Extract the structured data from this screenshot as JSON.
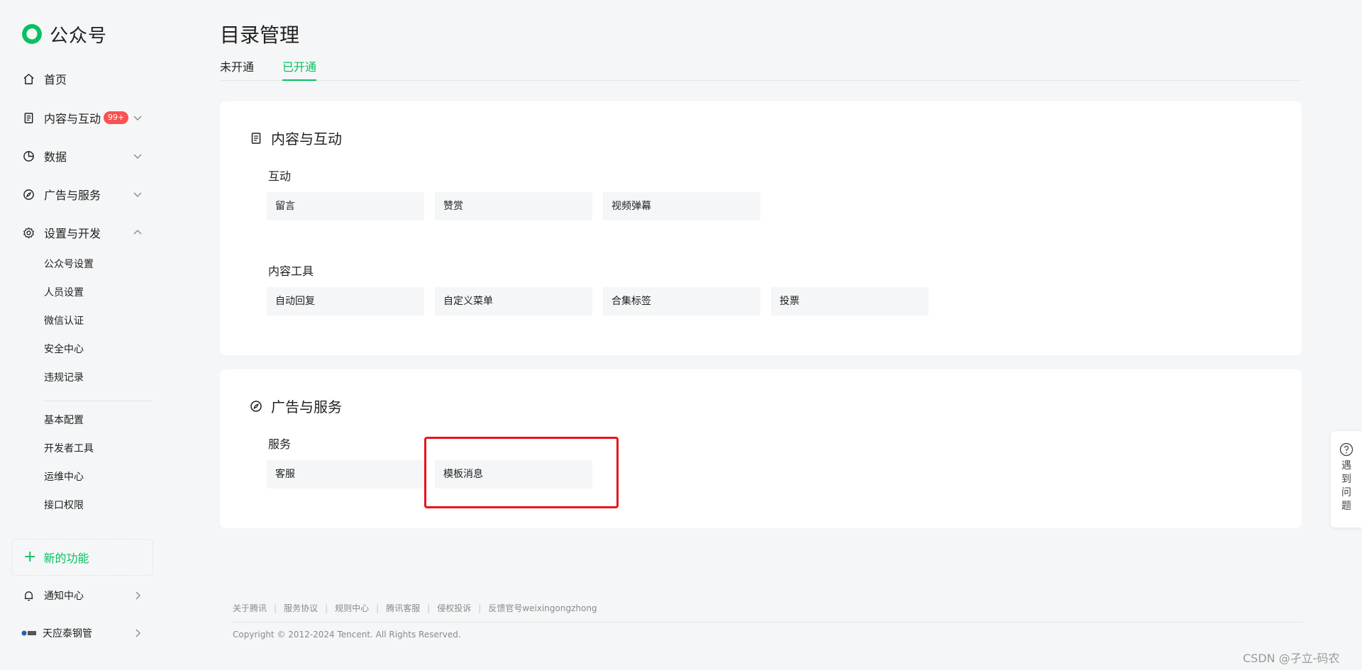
{
  "brand": {
    "name": "公众号",
    "color": "#07c160"
  },
  "sidebar": {
    "nav": [
      {
        "label": "首页",
        "icon": "home-icon"
      },
      {
        "label": "内容与互动",
        "icon": "document-icon",
        "badge": "99+",
        "chevron": "chevron-down-icon"
      },
      {
        "label": "数据",
        "icon": "pie-chart-icon",
        "chevron": "chevron-down-icon"
      },
      {
        "label": "广告与服务",
        "icon": "compass-icon",
        "chevron": "chevron-down-icon"
      },
      {
        "label": "设置与开发",
        "icon": "gear-icon",
        "chevron": "chevron-up-icon",
        "expanded": true
      }
    ],
    "settings_sub": [
      "公众号设置",
      "人员设置",
      "微信认证",
      "安全中心",
      "违规记录"
    ],
    "dev_sub": [
      "基本配置",
      "开发者工具",
      "运维中心",
      "接口权限"
    ],
    "new_feature": {
      "icon": "plus-icon",
      "label": "新的功能"
    },
    "notification": {
      "label": "通知中心",
      "icon": "bell-icon",
      "chevron": "chevron-right-icon"
    },
    "account": {
      "label": "天应泰钢管",
      "icon": "account-logo-icon",
      "chevron": "chevron-right-icon"
    }
  },
  "main": {
    "title": "目录管理",
    "tabs": [
      {
        "label": "未开通",
        "active": false
      },
      {
        "label": "已开通",
        "active": true
      }
    ],
    "sections": [
      {
        "title": "内容与互动",
        "icon": "document-icon",
        "groups": [
          {
            "label": "互动",
            "items": [
              "留言",
              "赞赏",
              "视频弹幕"
            ]
          },
          {
            "label": "内容工具",
            "items": [
              "自动回复",
              "自定义菜单",
              "合集标签",
              "投票"
            ]
          }
        ]
      },
      {
        "title": "广告与服务",
        "icon": "compass-icon",
        "groups": [
          {
            "label": "服务",
            "items": [
              "客服",
              "模板消息"
            ]
          }
        ]
      }
    ],
    "highlight_color": "#e8141b"
  },
  "footer": {
    "links": [
      "关于腾讯",
      "服务协议",
      "规则中心",
      "腾讯客服",
      "侵权投诉",
      "反馈官号weixingongzhong"
    ],
    "copyright": "Copyright © 2012-2024 Tencent. All Rights Reserved."
  },
  "help": {
    "icon": "question-circle-icon",
    "chars": [
      "遇",
      "到",
      "问",
      "题"
    ]
  },
  "watermark": "CSDN @孑立-码农"
}
